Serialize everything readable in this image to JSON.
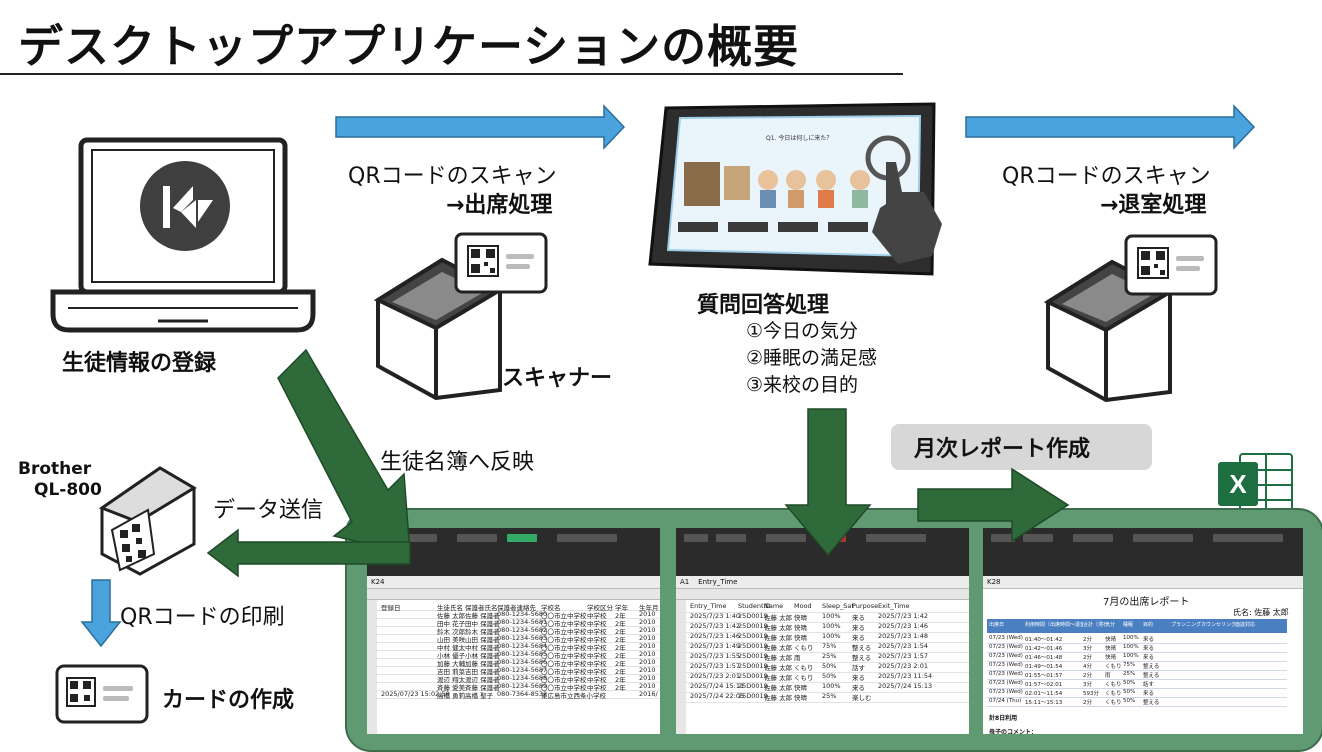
{
  "title": "デスクトップアプリケーションの概要",
  "laptop": {
    "label": "生徒情報の登録",
    "icon": "laptop-icon",
    "logo_icon": "kivy-logo-icon"
  },
  "scan_in": {
    "line1": "QRコードのスキャン",
    "line2": "→出席処理"
  },
  "scan_out": {
    "line1": "QRコードのスキャン",
    "line2": "→退室処理"
  },
  "scanner": {
    "label": "スキャナー",
    "icon": "qr-scanner-icon"
  },
  "tablet": {
    "icon": "tablet-icon",
    "question": "Q1. 今日は何しに来た？",
    "heading": "質問回答処理",
    "items": [
      "①今日の気分",
      "②睡眠の満足感",
      "③来校の目的"
    ]
  },
  "monthly_report": {
    "label": "月次レポート作成",
    "excel_icon": "excel-icon",
    "excel_letter": "X"
  },
  "printer": {
    "name_line1": "Brother",
    "name_line2": "QL-800",
    "icon": "label-printer-icon"
  },
  "register_flow": {
    "label": "生徒名簿へ反映"
  },
  "data_send": {
    "label": "データ送信"
  },
  "qr_print": {
    "label": "QRコードの印刷"
  },
  "card": {
    "label": "カードの作成",
    "icon": "qr-card-icon"
  },
  "sheet1": {
    "cellref": "K24",
    "headers": [
      "登録日",
      "生徒氏名",
      "保護者氏名",
      "保護者連絡先",
      "学校名",
      "学校区分",
      "学年",
      "生年月"
    ],
    "rows": [
      [
        "",
        "佐藤 太郎",
        "佐藤 保護者",
        "080-1234-5680",
        "〇〇市立中学校",
        "中学校",
        "2年",
        "2010"
      ],
      [
        "",
        "田中 花子",
        "田中 保護者",
        "080-1234-5681",
        "〇〇市立中学校",
        "中学校",
        "2年",
        "2010"
      ],
      [
        "",
        "鈴木 次郎",
        "鈴木 保護者",
        "080-1234-5682",
        "〇〇市立中学校",
        "中学校",
        "2年",
        "2010"
      ],
      [
        "",
        "山田 美咲",
        "山田 保護者",
        "080-1234-5683",
        "〇〇市立中学校",
        "中学校",
        "2年",
        "2010"
      ],
      [
        "",
        "中村 健太",
        "中村 保護者",
        "080-1234-5684",
        "〇〇市立中学校",
        "中学校",
        "2年",
        "2010"
      ],
      [
        "",
        "小林 優子",
        "小林 保護者",
        "080-1234-5685",
        "〇〇市立中学校",
        "中学校",
        "2年",
        "2010"
      ],
      [
        "",
        "加藤 大輔",
        "加藤 保護者",
        "080-1234-5686",
        "〇〇市立中学校",
        "中学校",
        "2年",
        "2010"
      ],
      [
        "",
        "吉田 莉菜",
        "吉田 保護者",
        "080-1234-5687",
        "〇〇市立中学校",
        "中学校",
        "2年",
        "2010"
      ],
      [
        "",
        "渡辺 翔太",
        "渡辺 保護者",
        "080-1234-5688",
        "〇〇市立中学校",
        "中学校",
        "2年",
        "2010"
      ],
      [
        "",
        "斉藤 愛美",
        "斉藤 保護者",
        "080-1234-5689",
        "〇〇市立中学校",
        "中学校",
        "2年",
        "2010"
      ],
      [
        "2025/07/23 15:02:50",
        "高橋 勇莉",
        "高橋 聖子",
        "080-7364-8532",
        "東広島市立西条小学校",
        "",
        "",
        "2016/"
      ]
    ]
  },
  "sheet2": {
    "cellref": "A1",
    "formula": "Entry_Time",
    "headers": [
      "Entry_Time",
      "StudentID",
      "Name",
      "Mood",
      "Sleep_Sat",
      "Purpose",
      "Exit_Time"
    ],
    "rows": [
      [
        "2025/7/23 1:40",
        "25D0019",
        "佐藤 太郎",
        "快晴",
        "100%",
        "来る",
        "2025/7/23 1:42"
      ],
      [
        "2025/7/23 1:42",
        "25D0019",
        "佐藤 太郎",
        "快晴",
        "100%",
        "来る",
        "2025/7/23 1:46"
      ],
      [
        "2025/7/23 1:46",
        "25D0019",
        "佐藤 太郎",
        "快晴",
        "100%",
        "来る",
        "2025/7/23 1:48"
      ],
      [
        "2025/7/23 1:49",
        "25D0019",
        "佐藤 太郎",
        "くもり",
        "75%",
        "整える",
        "2025/7/23 1:54"
      ],
      [
        "2025/7/23 1:55",
        "25D0019",
        "佐藤 太郎",
        "雨",
        "25%",
        "整える",
        "2025/7/23 1:57"
      ],
      [
        "2025/7/23 1:57",
        "25D0019",
        "佐藤 太郎",
        "くもり",
        "50%",
        "話す",
        "2025/7/23 2:01"
      ],
      [
        "2025/7/23 2:01",
        "25D0019",
        "佐藤 太郎",
        "くもり",
        "50%",
        "来る",
        "2025/7/23 11:54"
      ],
      [
        "2025/7/24 15:11",
        "25D0019",
        "佐藤 太郎",
        "快晴",
        "100%",
        "来る",
        "2025/7/24 15:13"
      ],
      [
        "2025/7/24 22:05",
        "25D0019",
        "佐藤 太郎",
        "快晴",
        "25%",
        "楽しむ",
        ""
      ]
    ]
  },
  "sheet3": {
    "cellref": "K28",
    "title": "7月の出席レポート",
    "name": "氏名: 佐藤 太郎",
    "headers": [
      "出席日",
      "利用時間（出席時間～退室時間）",
      "合計（滞在時間）",
      "気分",
      "睡眠",
      "目的",
      "プランニング",
      "カウンセリング",
      "面談対応"
    ],
    "rows": [
      [
        "07/23 (Wed)",
        "01:40～01:42",
        "2分",
        "快晴",
        "100%",
        "来る"
      ],
      [
        "07/23 (Wed)",
        "01:42～01:46",
        "3分",
        "快晴",
        "100%",
        "来る"
      ],
      [
        "07/23 (Wed)",
        "01:46～01:48",
        "2分",
        "快晴",
        "100%",
        "来る"
      ],
      [
        "07/23 (Wed)",
        "01:49～01:54",
        "4分",
        "くもり",
        "75%",
        "整える"
      ],
      [
        "07/23 (Wed)",
        "01:55～01:57",
        "2分",
        "雨",
        "25%",
        "整える"
      ],
      [
        "07/23 (Wed)",
        "01:57～02:01",
        "3分",
        "くもり",
        "50%",
        "話す"
      ],
      [
        "07/23 (Wed)",
        "02:01～11:54",
        "593分",
        "くもり",
        "50%",
        "来る"
      ],
      [
        "07/24 (Thu)",
        "15:11～15:13",
        "2分",
        "くもり",
        "50%",
        "整える"
      ]
    ],
    "summary": "計8日利用",
    "comment": "母子のコメント："
  }
}
